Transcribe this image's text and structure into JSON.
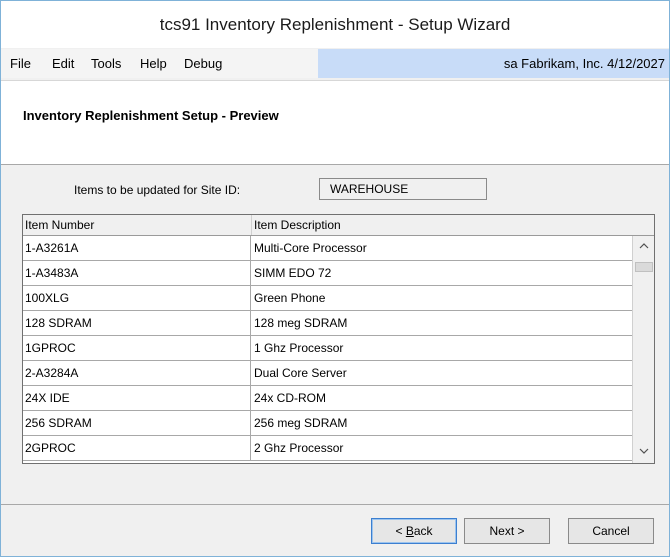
{
  "window": {
    "title": "tcs91 Inventory Replenishment - Setup  Wizard"
  },
  "menu": {
    "items": [
      "File",
      "Edit",
      "Tools",
      "Help",
      "Debug"
    ],
    "user_info": "sa  Fabrikam, Inc.  4/12/2027"
  },
  "header": {
    "title": "Inventory Replenishment Setup - Preview"
  },
  "site": {
    "label": "Items to be updated for  Site ID:",
    "value": "WAREHOUSE"
  },
  "grid": {
    "columns": [
      "Item Number",
      "Item Description"
    ],
    "rows": [
      [
        "1-A3261A",
        "Multi-Core Processor"
      ],
      [
        "1-A3483A",
        "SIMM EDO 72"
      ],
      [
        "100XLG",
        "Green Phone"
      ],
      [
        "128 SDRAM",
        "128 meg SDRAM"
      ],
      [
        "1GPROC",
        "1 Ghz Processor"
      ],
      [
        "2-A3284A",
        "Dual Core Server"
      ],
      [
        "24X IDE",
        "24x CD-ROM"
      ],
      [
        "256 SDRAM",
        "256 meg SDRAM"
      ],
      [
        "2GPROC",
        "2 Ghz Processor"
      ]
    ],
    "scroll_up_icon": "chevron-up-icon",
    "scroll_down_icon": "chevron-down-icon"
  },
  "buttons": {
    "back_prefix": "< ",
    "back_accel": "B",
    "back_rest": "ack",
    "next": "Next >",
    "cancel": "Cancel"
  },
  "colors": {
    "accent": "#c8dcf8",
    "window_border": "#7fb2d8",
    "primary_button_border": "#3c7fd0"
  }
}
